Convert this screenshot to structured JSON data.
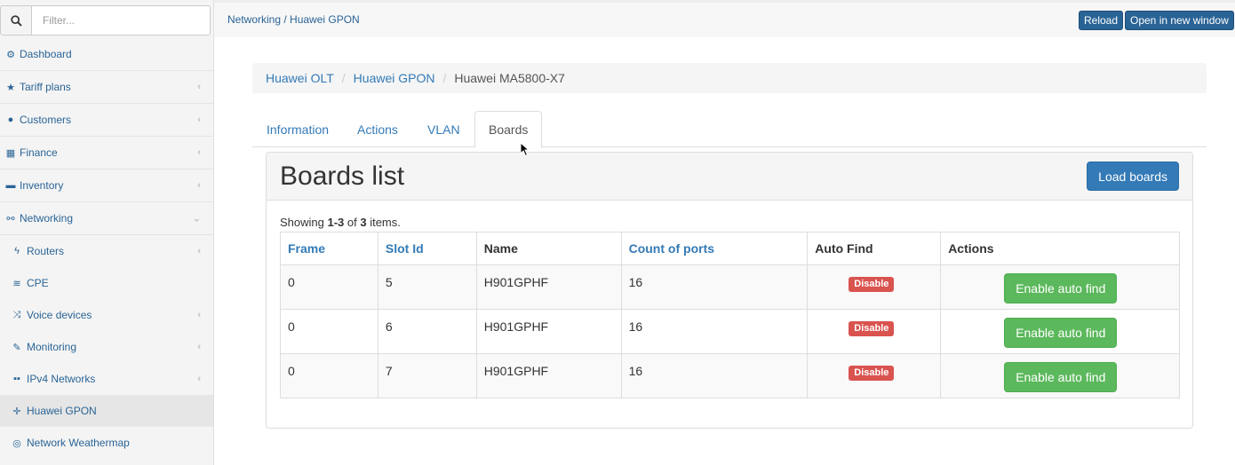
{
  "sidebar": {
    "search": {
      "placeholder": "Filter...",
      "icon": "search-icon"
    },
    "items": [
      {
        "label": "Dashboard",
        "icon": "tachometer-icon",
        "glyph": "⚙",
        "chevron": ""
      },
      {
        "label": "Tariff plans",
        "icon": "star-icon",
        "glyph": "★",
        "chevron": "‹"
      },
      {
        "label": "Customers",
        "icon": "user-icon",
        "glyph": "●",
        "chevron": "‹"
      },
      {
        "label": "Finance",
        "icon": "calculator-icon",
        "glyph": "▦",
        "chevron": "‹"
      },
      {
        "label": "Inventory",
        "icon": "folder-icon",
        "glyph": "▬",
        "chevron": "‹"
      },
      {
        "label": "Networking",
        "icon": "sitemap-icon",
        "glyph": "⚯",
        "chevron": "⌄"
      }
    ],
    "subitems": [
      {
        "label": "Routers",
        "icon": "bolt-icon",
        "glyph": "ϟ",
        "chevron": "‹"
      },
      {
        "label": "CPE",
        "icon": "wifi-icon",
        "glyph": "≋",
        "chevron": ""
      },
      {
        "label": "Voice devices",
        "icon": "random-icon",
        "glyph": "⤨",
        "chevron": "‹"
      },
      {
        "label": "Monitoring",
        "icon": "magic-icon",
        "glyph": "✎",
        "chevron": "‹"
      },
      {
        "label": "IPv4 Networks",
        "icon": "th-large-icon",
        "glyph": "▪▪",
        "chevron": "‹"
      },
      {
        "label": "Huawei GPON",
        "icon": "arrows-icon",
        "glyph": "✛",
        "chevron": ""
      },
      {
        "label": "Network Weathermap",
        "icon": "globe-icon",
        "glyph": "◎",
        "chevron": ""
      }
    ]
  },
  "topbar": {
    "title": "Networking / Huawei GPON",
    "reload": "Reload",
    "open_new_window": "Open in new window"
  },
  "breadcrumb": {
    "items": [
      "Huawei OLT",
      "Huawei GPON"
    ],
    "current": "Huawei MA5800-X7"
  },
  "tabs": [
    "Information",
    "Actions",
    "VLAN",
    "Boards"
  ],
  "panel": {
    "title": "Boards list",
    "load_button": "Load boards",
    "summary_prefix": "Showing ",
    "summary_range": "1-3",
    "summary_mid": " of ",
    "summary_total": "3",
    "summary_suffix": " items."
  },
  "table": {
    "columns": [
      "Frame",
      "Slot Id",
      "Name",
      "Count of ports",
      "Auto Find",
      "Actions"
    ],
    "rows": [
      {
        "frame": "0",
        "slot": "5",
        "name": "H901GPHF",
        "ports": "16",
        "auto_find": "Disable",
        "action": "Enable auto find"
      },
      {
        "frame": "0",
        "slot": "6",
        "name": "H901GPHF",
        "ports": "16",
        "auto_find": "Disable",
        "action": "Enable auto find"
      },
      {
        "frame": "0",
        "slot": "7",
        "name": "H901GPHF",
        "ports": "16",
        "auto_find": "Disable",
        "action": "Enable auto find"
      }
    ]
  },
  "colors": {
    "link": "#337ab7",
    "danger": "#d9534f",
    "success": "#5cb85c",
    "topbar_button": "#2a6496"
  }
}
